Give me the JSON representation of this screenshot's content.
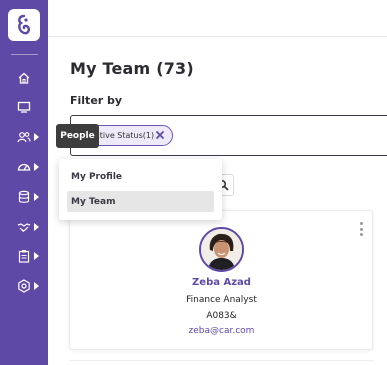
{
  "colors": {
    "brand": "#5e4aa6",
    "sidebar_bg": "#5e4aa6",
    "chip_bg": "#efeaf9",
    "tooltip_bg": "#3d3d3d"
  },
  "sidebar": {
    "logo_icon": "hand-logo-icon",
    "items": [
      {
        "icon": "home-icon",
        "has_caret": false
      },
      {
        "icon": "monitor-icon",
        "has_caret": false
      },
      {
        "icon": "people-icon",
        "has_caret": true
      },
      {
        "icon": "gauge-icon",
        "has_caret": true
      },
      {
        "icon": "database-icon",
        "has_caret": true
      },
      {
        "icon": "handshake-icon",
        "has_caret": true
      },
      {
        "icon": "clipboard-icon",
        "has_caret": true
      },
      {
        "icon": "settings-icon",
        "has_caret": true
      }
    ]
  },
  "tooltip": {
    "label": "People"
  },
  "main": {
    "title": "My Team (73)",
    "filter_label": "Filter by",
    "filter_chip": {
      "label": "Active Status(1)"
    }
  },
  "menu": {
    "items": [
      {
        "label": "My Profile",
        "active": false
      },
      {
        "label": "My Team",
        "active": true
      }
    ]
  },
  "employee_card": {
    "name": "Zeba Azad",
    "role": "Finance Analyst",
    "code": "A083&",
    "email": "zeba@car.com"
  }
}
